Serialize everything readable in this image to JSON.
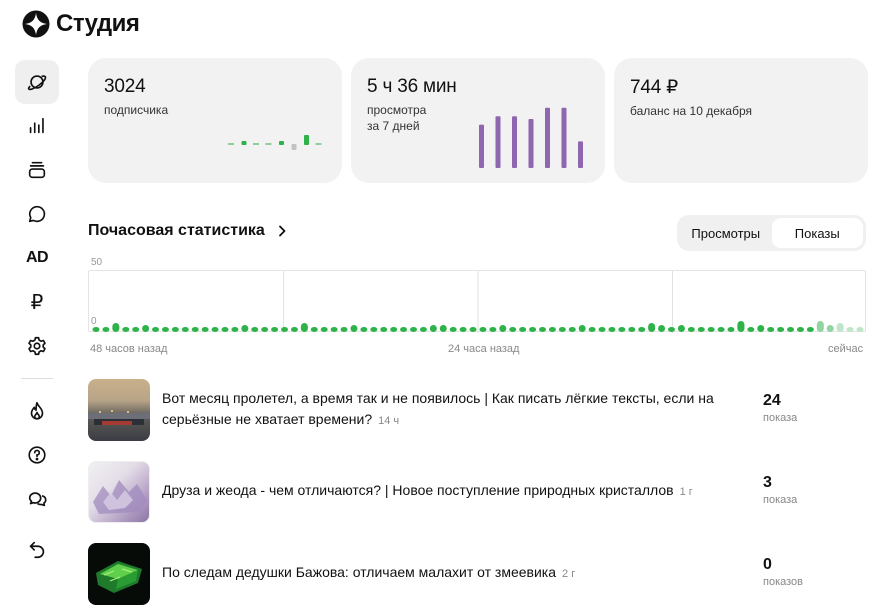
{
  "app": {
    "title": "Студия"
  },
  "sidebar": {
    "items": [
      {
        "icon": "planet-icon"
      },
      {
        "icon": "bar-chart-icon"
      },
      {
        "icon": "stack-icon"
      },
      {
        "icon": "comment-icon"
      },
      {
        "icon": "ad-icon",
        "label": "AD"
      },
      {
        "icon": "ruble-icon",
        "label": "₽"
      },
      {
        "icon": "gear-icon"
      },
      {
        "icon": "flame-icon"
      },
      {
        "icon": "help-icon"
      },
      {
        "icon": "chat-icon"
      },
      {
        "icon": "back-icon"
      }
    ]
  },
  "cards": [
    {
      "value": "3024",
      "label": "подписчика"
    },
    {
      "value": "5 ч 36 мин",
      "label": "просмотра",
      "label2": "за 7 дней",
      "bars": [
        0.62,
        0.74,
        0.74,
        0.7,
        0.86,
        0.86,
        0.38
      ]
    },
    {
      "value": "744 ₽",
      "label": "баланс на 10 декабря"
    }
  ],
  "subscriber_trend": [
    0,
    1,
    0,
    0,
    1,
    -2,
    3,
    0
  ],
  "hourly": {
    "title": "Почасовая статистика",
    "toggle": {
      "views": "Просмотры",
      "impressions": "Показы",
      "active": "impressions"
    },
    "y_max_label": "50",
    "y_min_label": "0",
    "x_labels": {
      "left": "48 часов назад",
      "middle": "24 часа назад",
      "right": "сейчас"
    },
    "values": [
      1,
      1,
      3,
      1,
      1,
      2,
      1,
      1,
      1,
      1,
      1,
      1,
      1,
      1,
      1,
      2,
      1,
      1,
      1,
      1,
      1,
      3,
      1,
      1,
      1,
      1,
      2,
      1,
      1,
      1,
      1,
      1,
      1,
      1,
      2,
      2,
      1,
      1,
      1,
      1,
      1,
      2,
      1,
      1,
      1,
      1,
      1,
      1,
      1,
      2,
      1,
      1,
      1,
      1,
      1,
      1,
      3,
      2,
      1,
      2,
      1,
      1,
      1,
      1,
      1,
      4,
      1,
      2,
      1,
      1,
      1,
      1,
      1,
      4,
      2,
      3,
      1,
      1
    ],
    "faded_from": 73
  },
  "articles": [
    {
      "title": "Вот месяц пролетел, а время так и не появилось | Как писать лёгкие тексты, если на серьёзные не хватает времени?",
      "age": "14 ч",
      "count": "24",
      "unit": "показа"
    },
    {
      "title": "Друза и жеода - чем отличаются? | Новое поступление природных кристаллов",
      "age": "1 г",
      "count": "3",
      "unit": "показа"
    },
    {
      "title": "По следам дедушки Бажова: отличаем малахит от змеевика",
      "age": "2 г",
      "count": "0",
      "unit": "показов"
    }
  ]
}
